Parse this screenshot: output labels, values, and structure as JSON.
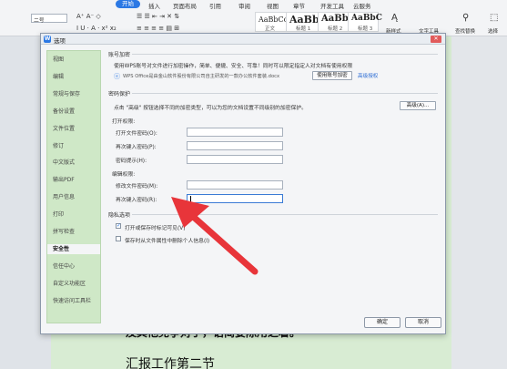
{
  "ribbon": {
    "tabs": [
      "开始",
      "插入",
      "页面布局",
      "引用",
      "审阅",
      "视图",
      "章节",
      "开发工具",
      "云服务"
    ],
    "font_size": "二号",
    "styles": [
      {
        "preview": "AaBbCcDd",
        "name": "正文"
      },
      {
        "preview": "AaBb",
        "name": "标题 1"
      },
      {
        "preview": "AaBb(",
        "name": "标题 2"
      },
      {
        "preview": "AaBbC",
        "name": "标题 3"
      }
    ],
    "new_style": "新样式",
    "text_tools": "文字工具",
    "find_replace": "查找替换",
    "select": "选择"
  },
  "document": {
    "line1": "及其他竞争对手，语简要陈用之着。",
    "line2": "汇报工作第二节"
  },
  "dialog": {
    "title": "选项",
    "close": "✕",
    "sidebar": [
      "视图",
      "编辑",
      "常规与保存",
      "备份设置",
      "文件位置",
      "修订",
      "中文版式",
      "输出PDF",
      "用户信息",
      "打印",
      "拼写检查",
      "安全性",
      "信任中心",
      "自定义功能区",
      "快速访问工具栏"
    ],
    "active_index": 11,
    "account_section": "账号加密",
    "account_desc": "使用WPS账号对文件进行加密操作，简单、便捷、安全、可靠！同时可以限定指定人对文档有使用权限",
    "file_name": "WPS Office是由金山软件股份有限公司自主研发的一款办公软件套装.docx",
    "use_account_btn": "使用账号加密",
    "advanced_link": "高级授权",
    "password_section": "密码保护",
    "password_desc": "点击 \"高级\" 按钮选择不同的加密类型，可以为您的文档设置不同级别的加密保护。",
    "advanced_btn": "高级(A)...",
    "open_perm": "打开权限:",
    "open_pwd": "打开文件密码(O):",
    "open_pwd_again": "再次键入密码(P):",
    "pwd_hint": "密码提示(H):",
    "edit_perm": "编辑权限:",
    "edit_pwd": "修改文件密码(M):",
    "edit_pwd_again": "再次键入密码(R):",
    "privacy_section": "隐私选项",
    "privacy_opt1": "打开或保存时标记可见(V)",
    "privacy_opt2": "保存时从文件属性中删除个人信息(I)",
    "ok": "确定",
    "cancel": "取消"
  },
  "colors": {
    "accent": "#2b78e4",
    "sidebar_bg": "#cfe8c7",
    "doc_bg": "#d8ecd3",
    "arrow": "#e8353a"
  }
}
